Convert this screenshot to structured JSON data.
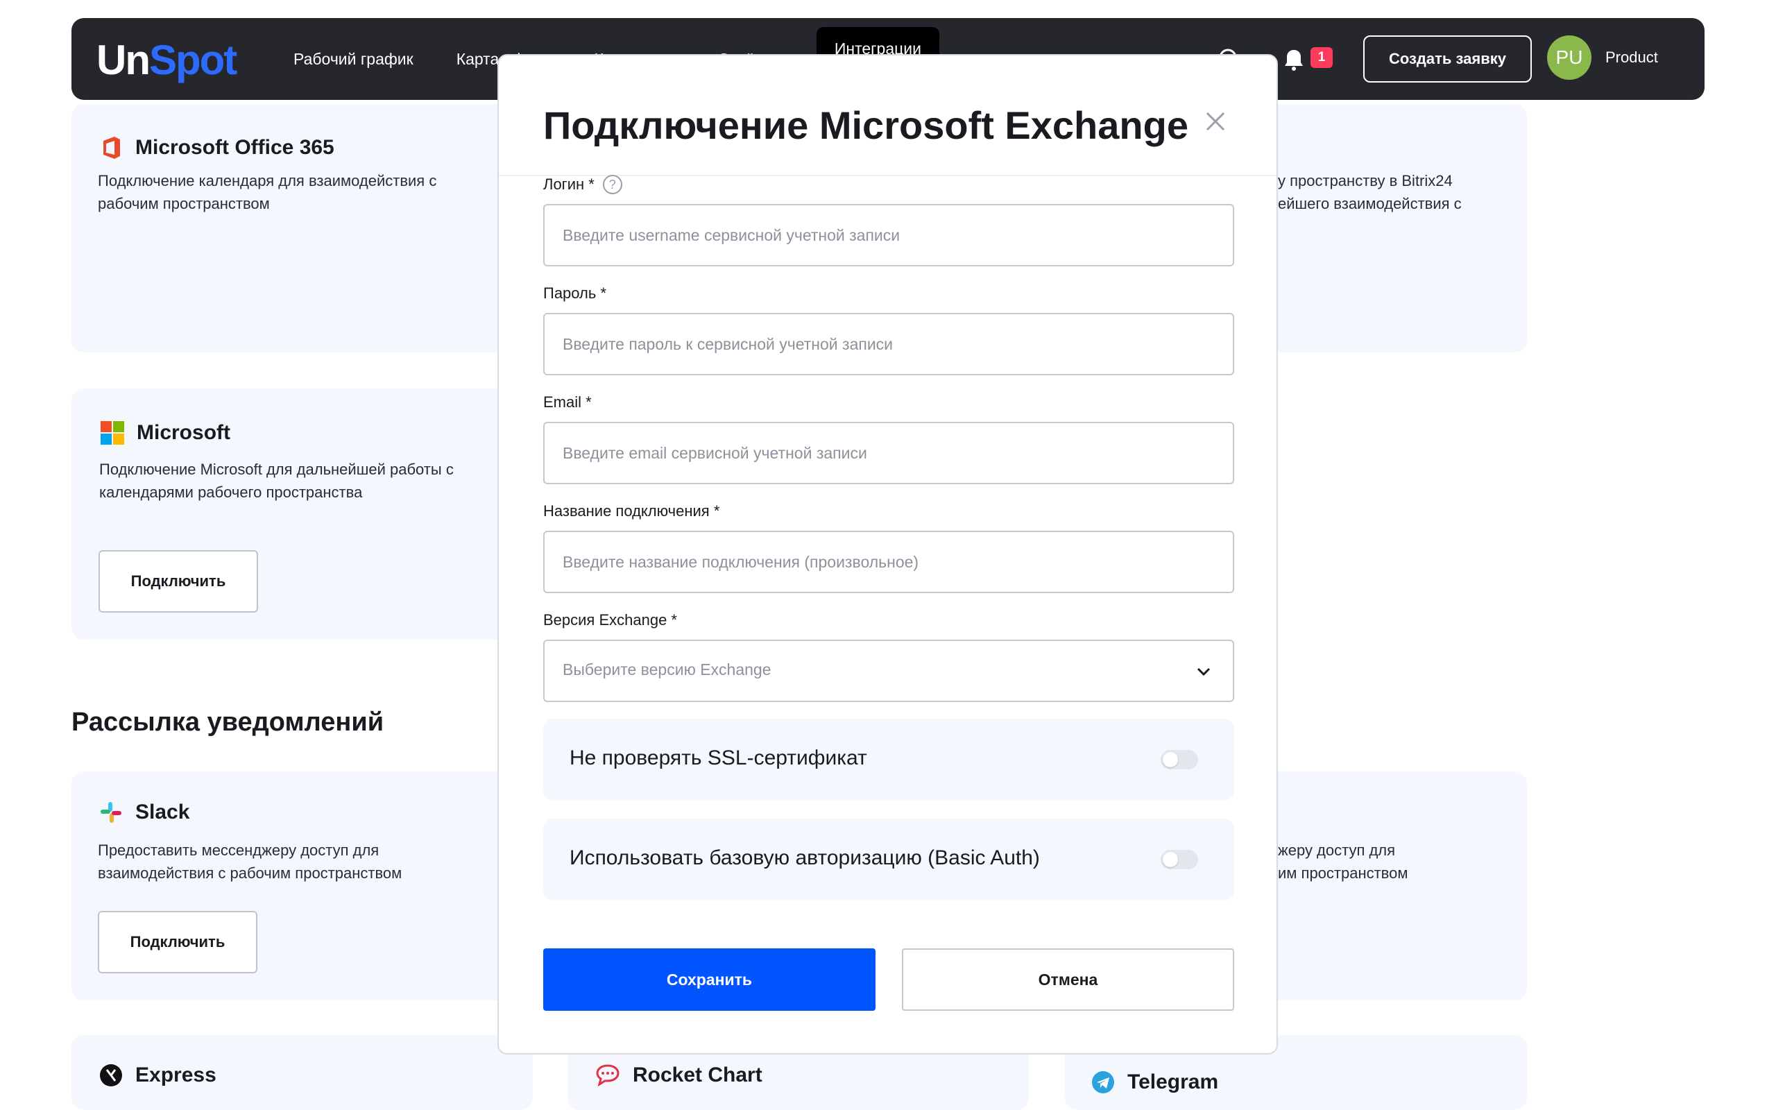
{
  "header": {
    "logo_part1": "Un",
    "logo_part2": "Spot",
    "nav": [
      "Рабочий график",
      "Карта офиса",
      "Календарь",
      "Отчёты",
      "Интеграции"
    ],
    "notification_count": "1",
    "create_request_label": "Создать заявку",
    "avatar_initials": "PU",
    "user_name": "Product"
  },
  "cards": {
    "office365": {
      "title": "Microsoft Office 365",
      "description": "Подключение календаря для взаимодействия с рабочим пространством"
    },
    "bitrix": {
      "description_line1": "у пространству в Bitrix24",
      "description_line2": "ейшего взаимодействия с"
    },
    "microsoft": {
      "title": "Microsoft",
      "description": "Подключение Microsoft для дальнейшей работы с календарями рабочего пространства",
      "button": "Подключить"
    },
    "slack": {
      "title": "Slack",
      "description": "Предоставить мессенджеру доступ для взаимодействия с рабочим пространством",
      "button": "Подключить"
    },
    "right_messenger": {
      "description_line1": "жеру доступ для",
      "description_line2": "им пространством"
    },
    "express": {
      "title": "Express"
    },
    "rocket": {
      "title": "Rocket Chart"
    },
    "telegram": {
      "title": "Telegram"
    }
  },
  "section": {
    "notifications_title": "Рассылка уведомлений"
  },
  "modal": {
    "title": "Подключение Microsoft Exchange",
    "fields": {
      "login": {
        "label": "Логин *",
        "placeholder": "Введите username сервисной учетной записи"
      },
      "password": {
        "label": "Пароль *",
        "placeholder": "Введите пароль к сервисной учетной записи"
      },
      "email": {
        "label": "Email *",
        "placeholder": "Введите email сервисной учетной записи"
      },
      "connection_name": {
        "label": "Название подключения *",
        "placeholder": "Введите название подключения (произвольное)"
      },
      "exchange_version": {
        "label": "Версия Exchange *",
        "placeholder": "Выберите версию Exchange"
      }
    },
    "toggles": {
      "skip_ssl": {
        "label": "Не проверять SSL-сертификат",
        "enabled": false
      },
      "basic_auth": {
        "label": "Использовать базовую авторизацию (Basic Auth)",
        "enabled": false
      }
    },
    "save_label": "Сохранить",
    "cancel_label": "Отмена"
  },
  "colors": {
    "header_bg": "#25272d",
    "accent": "#0055ff",
    "card_bg": "#f4f7fd",
    "badge": "#ff3b5c",
    "avatar": "#8ab84a"
  }
}
